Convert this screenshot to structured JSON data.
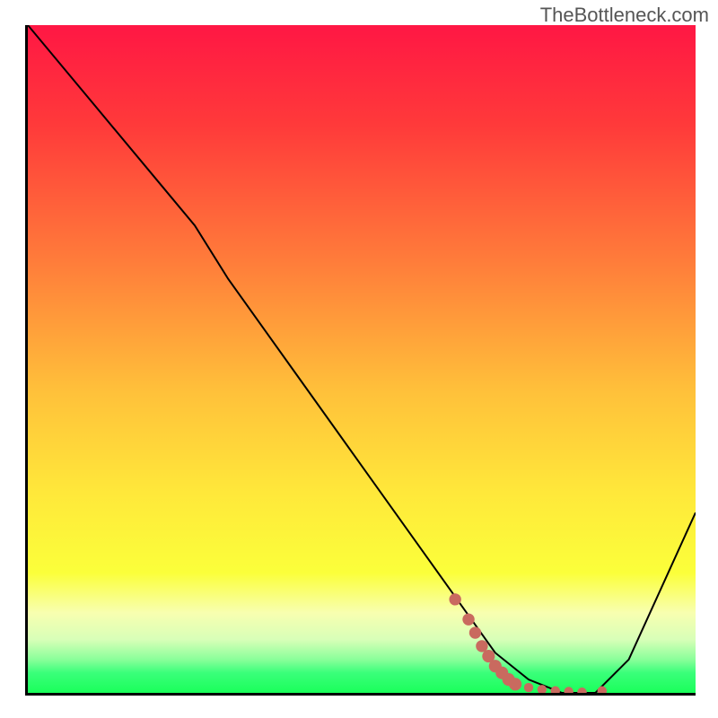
{
  "watermark": "TheBottleneck.com",
  "chart_data": {
    "type": "line",
    "title": "",
    "xlabel": "",
    "ylabel": "",
    "xlim": [
      0,
      100
    ],
    "ylim": [
      0,
      100
    ],
    "gradient_stops": [
      {
        "pos": 0,
        "color": "#ff1744"
      },
      {
        "pos": 15,
        "color": "#ff3a3a"
      },
      {
        "pos": 35,
        "color": "#ff7b3a"
      },
      {
        "pos": 55,
        "color": "#ffc13a"
      },
      {
        "pos": 70,
        "color": "#ffe83a"
      },
      {
        "pos": 82,
        "color": "#fbff3a"
      },
      {
        "pos": 88,
        "color": "#f8ffb0"
      },
      {
        "pos": 92,
        "color": "#d8ffb8"
      },
      {
        "pos": 95,
        "color": "#8aff9a"
      },
      {
        "pos": 97,
        "color": "#3aff7a"
      },
      {
        "pos": 100,
        "color": "#1aff5a"
      }
    ],
    "series": [
      {
        "name": "bottleneck-curve",
        "x": [
          0,
          10,
          20,
          25,
          30,
          40,
          50,
          60,
          65,
          70,
          75,
          80,
          85,
          90,
          100
        ],
        "y": [
          100,
          88,
          76,
          70,
          62,
          48,
          34,
          20,
          13,
          6,
          2,
          0,
          0,
          5,
          27
        ]
      }
    ],
    "marker_segment": {
      "name": "highlight-dots",
      "color": "#c96a5f",
      "points": [
        {
          "x": 64,
          "y": 14
        },
        {
          "x": 66,
          "y": 11
        },
        {
          "x": 67,
          "y": 9
        },
        {
          "x": 68,
          "y": 7
        },
        {
          "x": 69,
          "y": 5.5
        },
        {
          "x": 70,
          "y": 4
        },
        {
          "x": 71,
          "y": 3
        },
        {
          "x": 72,
          "y": 2
        },
        {
          "x": 73,
          "y": 1.3
        },
        {
          "x": 75,
          "y": 0.8
        },
        {
          "x": 77,
          "y": 0.5
        },
        {
          "x": 79,
          "y": 0.3
        },
        {
          "x": 81,
          "y": 0.2
        },
        {
          "x": 83,
          "y": 0.1
        },
        {
          "x": 86,
          "y": 0.3
        }
      ]
    }
  }
}
